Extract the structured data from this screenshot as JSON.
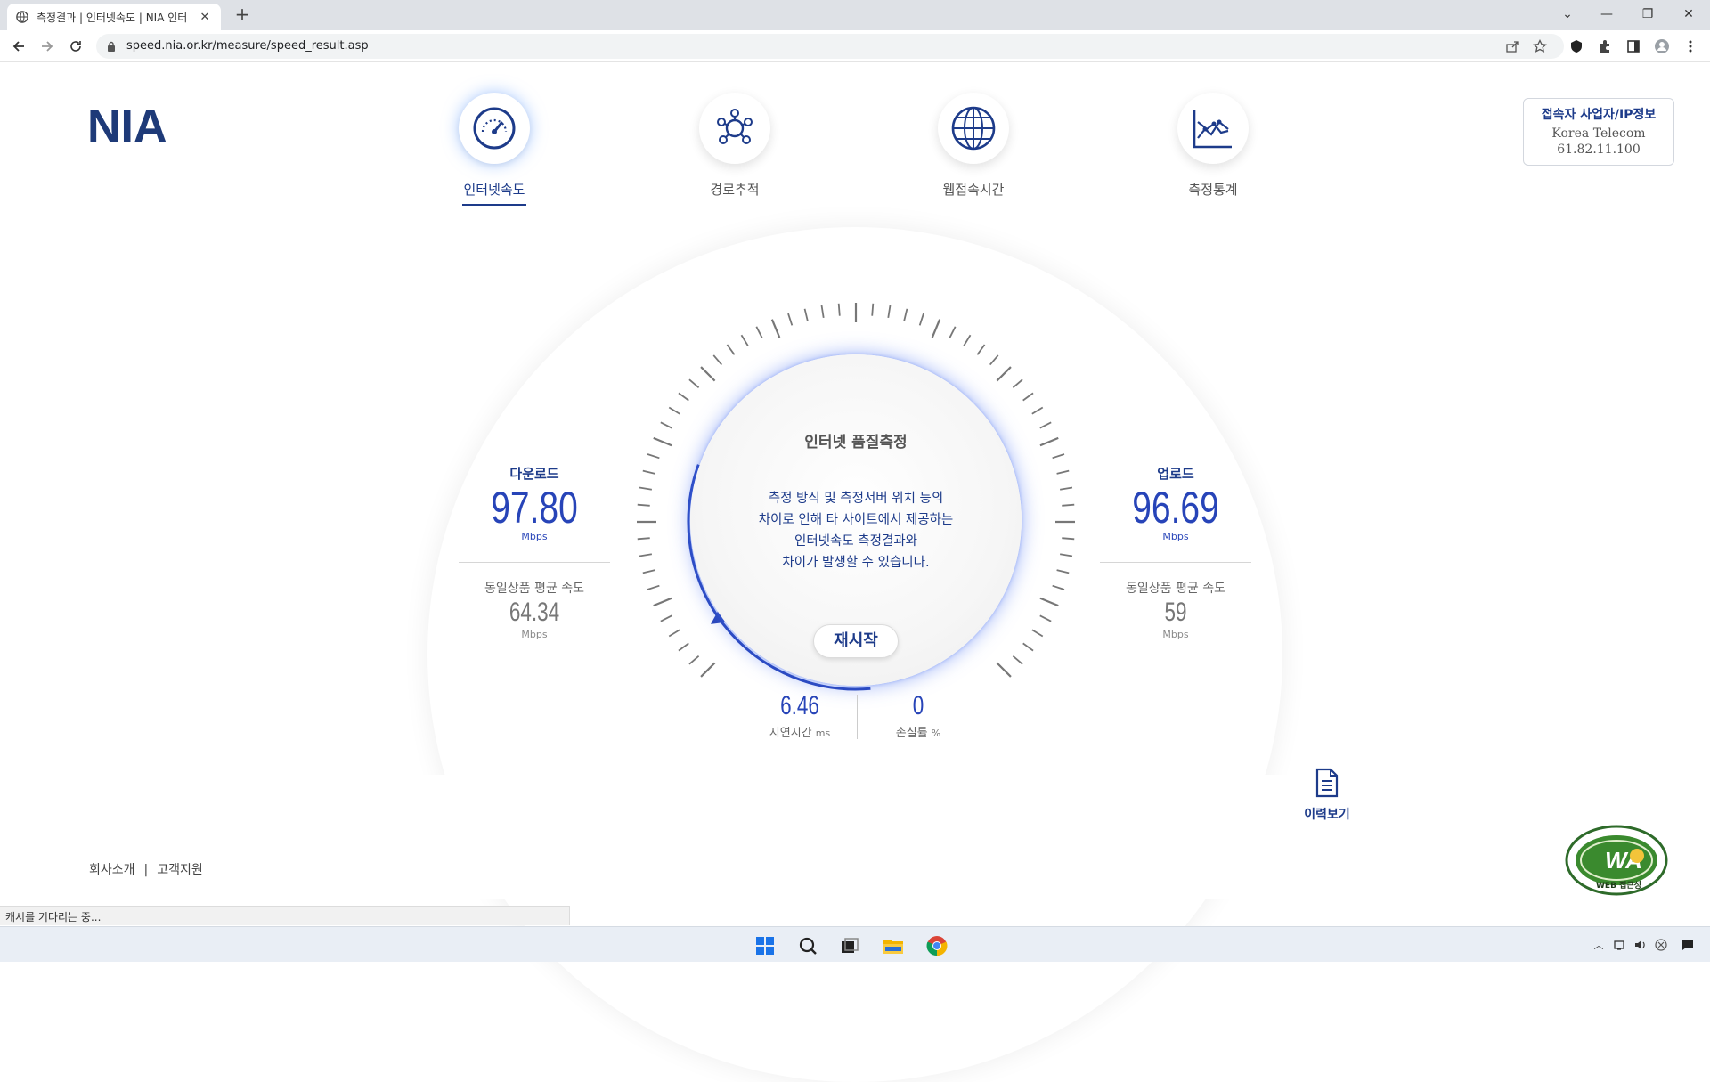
{
  "browser": {
    "tab_title": "측정결과 | 인터넷속도 | NIA 인터",
    "url": "speed.nia.or.kr/measure/speed_result.asp"
  },
  "header": {
    "logo": "NIA",
    "nav": [
      {
        "label": "인터넷속도",
        "icon": "speedometer-icon",
        "active": true
      },
      {
        "label": "경로추적",
        "icon": "route-trace-icon",
        "active": false
      },
      {
        "label": "웹접속시간",
        "icon": "globe-icon",
        "active": false
      },
      {
        "label": "측정통계",
        "icon": "statistics-chart-icon",
        "active": false
      }
    ],
    "ip_info": {
      "title": "접속자 사업자/IP정보",
      "isp": "Korea Telecom",
      "ip": "61.82.11.100"
    }
  },
  "gauge": {
    "title": "인터넷 품질측정",
    "message_lines": [
      "측정 방식 및 측정서버 위치 등의",
      "차이로 인해 타 사이트에서 제공하는",
      "인터넷속도 측정결과와",
      "차이가 발생할 수 있습니다."
    ],
    "restart_label": "재시작",
    "accent_color": "#2744b8"
  },
  "download": {
    "label": "다운로드",
    "value": "97.80",
    "unit": "Mbps",
    "avg_label": "동일상품 평균 속도",
    "avg_value": "64.34",
    "avg_unit": "Mbps"
  },
  "upload": {
    "label": "업로드",
    "value": "96.69",
    "unit": "Mbps",
    "avg_label": "동일상품 평균 속도",
    "avg_value": "59",
    "avg_unit": "Mbps"
  },
  "latency": {
    "value": "6.46",
    "label": "지연시간",
    "unit": "ms"
  },
  "loss": {
    "value": "0",
    "label": "손실률",
    "unit": "%"
  },
  "history": {
    "label": "이력보기",
    "icon": "document-icon"
  },
  "footer": {
    "about": "회사소개",
    "separator": "|",
    "support": "고객지원"
  },
  "badge": {
    "text_main": "WA",
    "text_sub": "WEB 접근성"
  },
  "status_bar": "캐시를 기다리는 중..."
}
